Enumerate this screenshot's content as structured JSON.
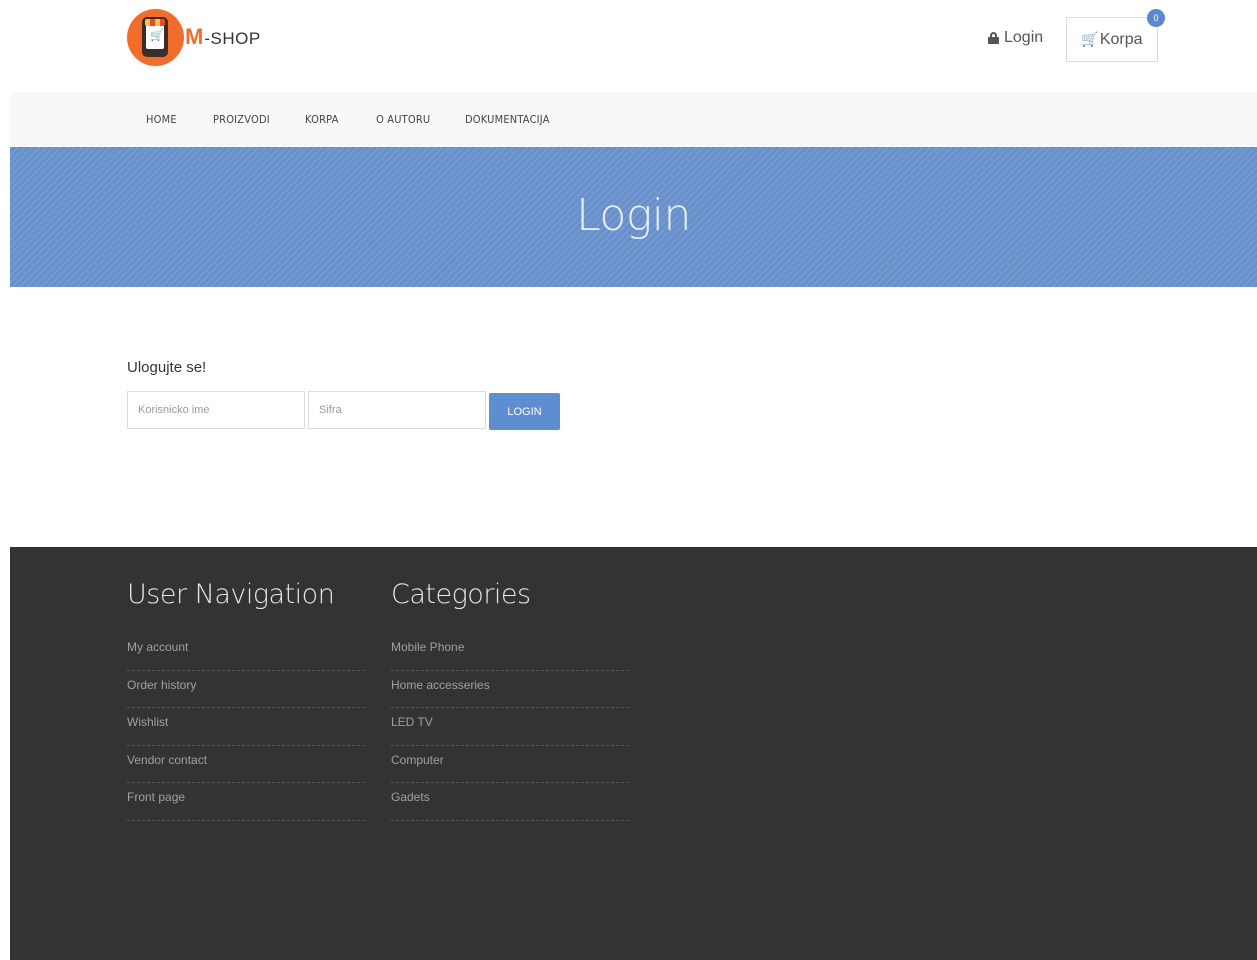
{
  "header": {
    "logo": {
      "brand_main": "M",
      "brand_sub": "-SHOP"
    },
    "login_link": "Login",
    "cart": {
      "label": "Korpa",
      "count": "0"
    }
  },
  "nav": {
    "items": [
      {
        "label": "HOME"
      },
      {
        "label": "PROIZVODI"
      },
      {
        "label": "KORPA"
      },
      {
        "label": "O AUTORU"
      },
      {
        "label": "DOKUMENTACIJA"
      }
    ]
  },
  "banner": {
    "title": "Login"
  },
  "login_form": {
    "heading": "Ulogujte se!",
    "username_placeholder": "Korisnicko ime",
    "password_placeholder": "Sifra",
    "button_label": "LOGIN"
  },
  "footer": {
    "user_navigation": {
      "title": "User Navigation",
      "items": [
        "My account",
        "Order history",
        "Wishlist",
        "Vendor contact",
        "Front page"
      ]
    },
    "categories": {
      "title": "Categories",
      "items": [
        "Mobile Phone",
        "Home accesseries",
        "LED TV",
        "Computer",
        "Gadets"
      ]
    }
  },
  "colors": {
    "brand_orange": "#f26c2c",
    "accent_blue": "#5e8dd2",
    "banner_blue": "#6b94cf",
    "footer_bg": "#333333"
  }
}
